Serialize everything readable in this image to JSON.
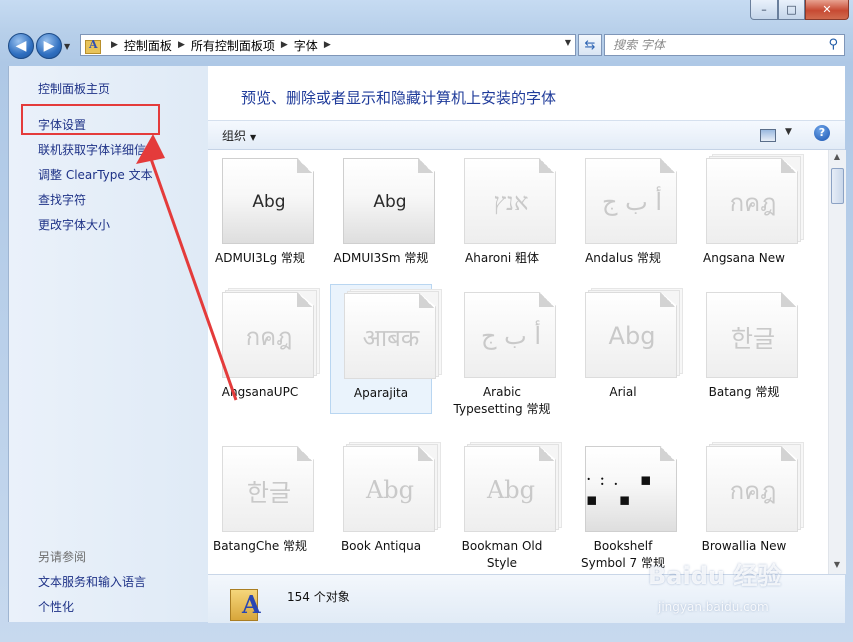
{
  "window": {
    "minimize": "–",
    "maximize": "□",
    "close": "✕"
  },
  "nav": {
    "back_glyph": "◀",
    "forward_glyph": "▶",
    "breadcrumbs": [
      "控制面板",
      "所有控制面板项",
      "字体"
    ],
    "search_placeholder": "搜索 字体"
  },
  "sidebar": {
    "items": [
      "控制面板主页",
      "字体设置",
      "联机获取字体详细信息",
      "调整 ClearType 文本",
      "查找字符",
      "更改字体大小"
    ],
    "see_also_header": "另请参阅",
    "see_also": [
      "文本服务和输入语言",
      "个性化"
    ]
  },
  "main": {
    "title": "预览、删除或者显示和隐藏计算机上安装的字体",
    "organize_label": "组织",
    "help_label": "?"
  },
  "fonts": [
    {
      "name": "ADMUI3Lg 常规",
      "sample": "Abg",
      "style": "dark",
      "stacked": false,
      "selected": false
    },
    {
      "name": "ADMUI3Sm 常规",
      "sample": "Abg",
      "style": "dark",
      "stacked": false,
      "selected": false
    },
    {
      "name": "Aharoni 粗体",
      "sample": "אנץ",
      "style": "light",
      "stacked": false,
      "selected": false
    },
    {
      "name": "Andalus 常规",
      "sample": "أ ب ج",
      "style": "light",
      "stacked": false,
      "selected": false
    },
    {
      "name": "Angsana New",
      "sample": "กคฎ",
      "style": "light",
      "stacked": true,
      "selected": false
    },
    {
      "name": "AngsanaUPC",
      "sample": "กคฎ",
      "style": "light",
      "stacked": true,
      "selected": false
    },
    {
      "name": "Aparajita",
      "sample": "आबक",
      "style": "light",
      "stacked": true,
      "selected": true
    },
    {
      "name": "Arabic Typesetting 常规",
      "sample": "أ ب ج",
      "style": "light",
      "stacked": false,
      "selected": false
    },
    {
      "name": "Arial",
      "sample": "Abg",
      "style": "light-sans",
      "stacked": true,
      "selected": false
    },
    {
      "name": "Batang 常规",
      "sample": "한글",
      "style": "light",
      "stacked": false,
      "selected": false
    },
    {
      "name": "BatangChe 常规",
      "sample": "한글",
      "style": "light",
      "stacked": false,
      "selected": false
    },
    {
      "name": "Book Antiqua",
      "sample": "Abg",
      "style": "light",
      "stacked": true,
      "selected": false
    },
    {
      "name": "Bookman Old Style",
      "sample": "Abg",
      "style": "light",
      "stacked": true,
      "selected": false
    },
    {
      "name": "Bookshelf Symbol 7 常规",
      "sample": "·:. ▪ ▪ ▪",
      "style": "dots",
      "stacked": false,
      "selected": false
    },
    {
      "name": "Browallia New",
      "sample": "กคฎ",
      "style": "light",
      "stacked": true,
      "selected": false
    }
  ],
  "status": {
    "count": "154 个对象"
  },
  "watermark": {
    "logo": "Baidu 经验",
    "url": "jingyan.baidu.com"
  },
  "annotation": {
    "color": "#e43b3b"
  }
}
